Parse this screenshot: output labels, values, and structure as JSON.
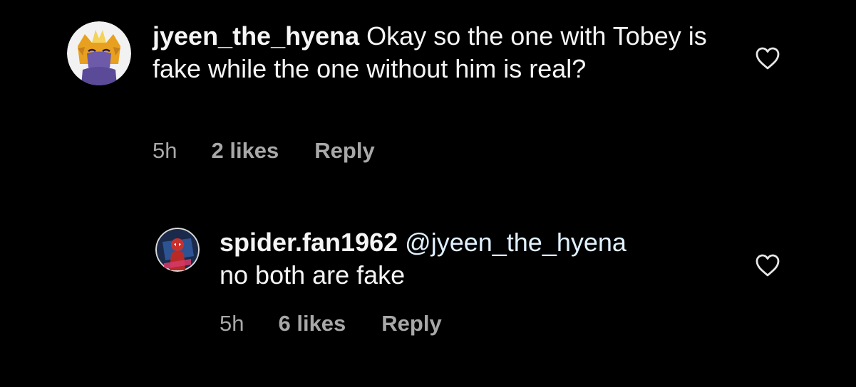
{
  "colors": {
    "background": "#000000",
    "text": "#f5f5f5",
    "meta": "#a8a8a8",
    "mention": "#e0f1ff"
  },
  "comments": [
    {
      "username": "jyeen_the_hyena",
      "text": "Okay so the one with Tobey is fake while the one without him is real?",
      "time": "5h",
      "likes": "2 likes",
      "reply_label": "Reply",
      "avatar_icon": "hyena-avatar",
      "like_icon": "heart-outline-icon"
    },
    {
      "username": "spider.fan1962",
      "mention": "@jyeen_the_hyena",
      "text": "no both are fake",
      "time": "5h",
      "likes": "6 likes",
      "reply_label": "Reply",
      "avatar_icon": "spiderman-avatar",
      "like_icon": "heart-outline-icon"
    }
  ]
}
